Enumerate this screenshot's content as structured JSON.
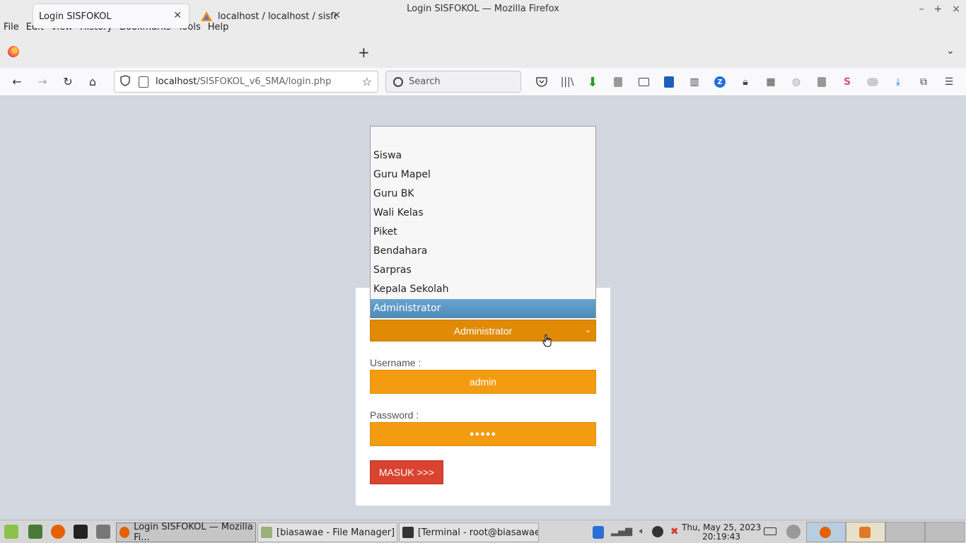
{
  "window": {
    "title": "Login SISFOKOL — Mozilla Firefox"
  },
  "menu": [
    "File",
    "Edit",
    "View",
    "History",
    "Bookmarks",
    "Tools",
    "Help"
  ],
  "tabs": [
    {
      "label": "Login SISFOKOL",
      "active": true
    },
    {
      "label": "localhost / localhost / sisfokol",
      "active": false
    }
  ],
  "navbar": {
    "url_host": "localhost",
    "url_path": "/SISFOKOL_v6_SMA/login.php",
    "search_placeholder": "Search"
  },
  "login": {
    "level_selected": "Administrator",
    "level_options": [
      "",
      "Siswa",
      "Guru Mapel",
      "Guru BK",
      "Wali Kelas",
      "Piket",
      "Bendahara",
      "Sarpras",
      "Kepala Sekolah",
      "Administrator"
    ],
    "username_label": "Username :",
    "username_value": "admin",
    "password_label": "Password :",
    "password_value": "●●●●●",
    "submit_label": "MASUK >>>"
  },
  "taskbar": {
    "tasks": [
      {
        "label": "Login SISFOKOL — Mozilla Fi...",
        "active": true
      },
      {
        "label": "[biasawae - File Manager]",
        "active": false
      },
      {
        "label": "[Terminal - root@biasawae /...",
        "active": false
      }
    ],
    "clock_date": "Thu, May 25, 2023",
    "clock_time": "20:19:43"
  },
  "colors": {
    "select_bg": "#e08a06",
    "field_bg": "#f39c12",
    "submit_bg": "#d9432f",
    "option_selected": "#5897c4",
    "page_bg": "#d3d8e0"
  }
}
